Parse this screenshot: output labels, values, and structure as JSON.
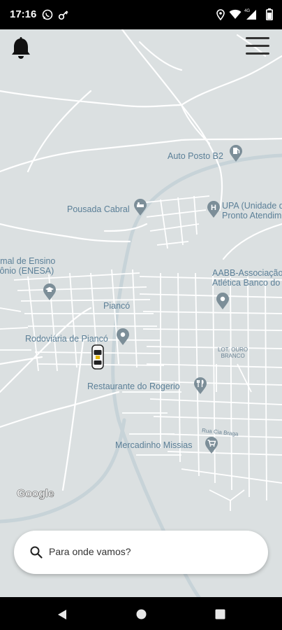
{
  "status_bar": {
    "time": "17:16",
    "left_icons": [
      "whatsapp-icon",
      "key-icon"
    ],
    "right_icons": [
      "location-icon",
      "wifi-icon",
      "4g-signal-icon",
      "battery-icon"
    ],
    "network_label": "4G"
  },
  "header": {
    "notifications_icon": "bell-icon",
    "menu_icon": "hamburger-menu-icon"
  },
  "map": {
    "background_color": "#dbe0e1",
    "road_color": "#ffffff",
    "highway_color": "#c5d2d7",
    "label_color": "#5b7f97",
    "pin_color": "#7c8e98",
    "places": [
      {
        "name": "Auto Posto B2",
        "icon": "fuel-icon"
      },
      {
        "name": "Pousada Cabral",
        "icon": "hotel-icon"
      },
      {
        "name": "UPA (Unidade de\nPronto Atendim",
        "icon": "hospital-icon"
      },
      {
        "name": "rmal de Ensino\ntônio (ENESA)",
        "icon": "school-icon"
      },
      {
        "name": "AABB-Associação\nAtlética Banco do",
        "icon": "place-icon"
      },
      {
        "name": "Piancó",
        "icon": ""
      },
      {
        "name": "Rodoviária de Piancó",
        "icon": "place-icon"
      },
      {
        "name": "Restaurante do Rogerio",
        "icon": "restaurant-icon"
      },
      {
        "name": "Mercadinho Missias",
        "icon": "shopping-icon"
      }
    ],
    "street_labels": [
      "LOT. OURO\nBRANCO",
      "Rua Cia Braga"
    ],
    "attribution": "Google",
    "vehicle_icon": "taxi-car-icon"
  },
  "search": {
    "placeholder": "Para onde vamos?",
    "icon": "search-icon"
  },
  "nav_bar": {
    "icons": [
      "back-icon",
      "home-icon",
      "recents-icon"
    ]
  }
}
